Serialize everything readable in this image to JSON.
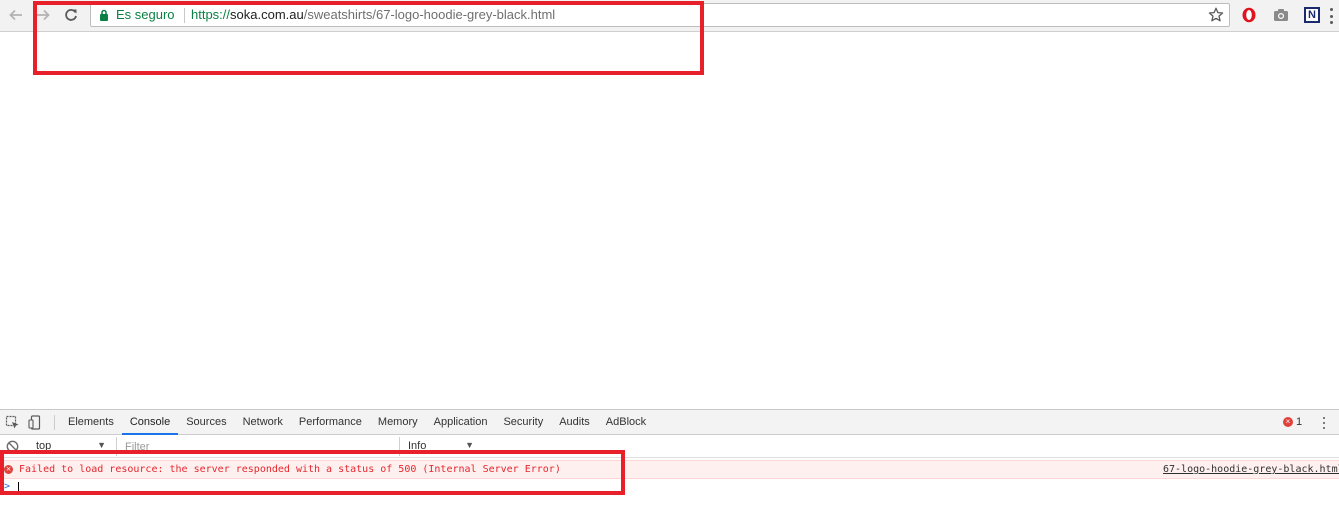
{
  "browser": {
    "security_label": "Es seguro",
    "url": {
      "scheme": "https://",
      "host": "soka.com.au",
      "path": "/sweatshirts/67-logo-hoodie-grey-black.html"
    },
    "icons": {
      "back": "back-arrow-icon",
      "forward": "forward-arrow-icon",
      "reload": "reload-icon",
      "lock": "lock-icon",
      "bookmark": "star-icon",
      "extensions": [
        "opera-icon",
        "camera-icon",
        "n-extension-icon"
      ],
      "menu": "kebab-menu-icon"
    },
    "colors": {
      "secure_green": "#0b8043",
      "annotation_red": "#e8202a"
    },
    "extension_n_letter": "N"
  },
  "devtools": {
    "tabs": [
      {
        "label": "Elements"
      },
      {
        "label": "Console",
        "active": true
      },
      {
        "label": "Sources"
      },
      {
        "label": "Network"
      },
      {
        "label": "Performance"
      },
      {
        "label": "Memory"
      },
      {
        "label": "Application"
      },
      {
        "label": "Security"
      },
      {
        "label": "Audits"
      },
      {
        "label": "AdBlock"
      }
    ],
    "error_count": "1",
    "filterbar": {
      "context": "top",
      "filter_placeholder": "Filter",
      "level": "Info"
    },
    "console": {
      "messages": [
        {
          "level": "error",
          "text": "Failed to load resource: the server responded with a status of 500 (Internal Server Error)",
          "source": "67-logo-hoodie-grey-black.html"
        }
      ],
      "prompt_symbol": ">"
    }
  }
}
